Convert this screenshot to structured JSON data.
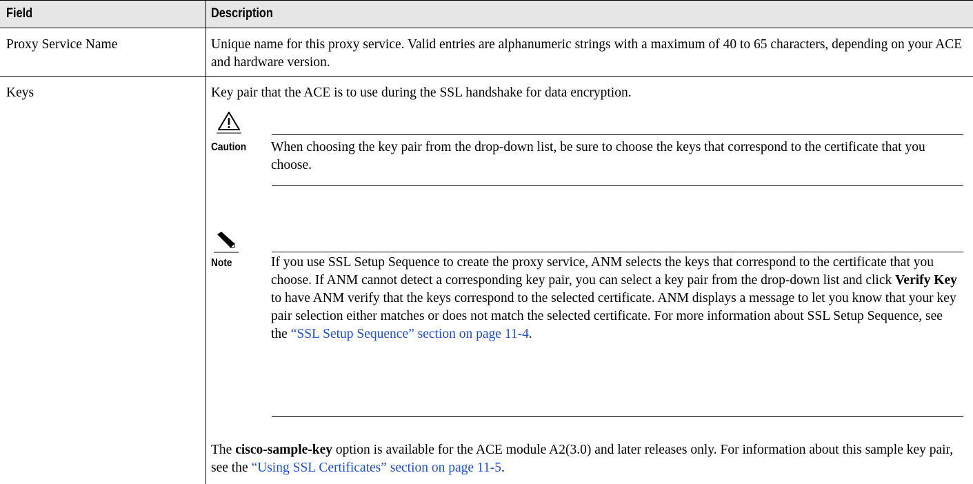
{
  "table": {
    "headers": {
      "field": "Field",
      "description": "Description"
    },
    "rows": [
      {
        "field": "Proxy Service Name",
        "description": "Unique name for this proxy service. Valid entries are alphanumeric strings with a maximum of 40 to 65 characters, depending on your ACE and hardware version."
      },
      {
        "field": "Keys",
        "description": "Key pair that the ACE is to use during the SSL handshake for data encryption.",
        "caution": {
          "label": "Caution",
          "icon": "caution-triangle-icon",
          "text": "When choosing the key pair from the drop-down list, be sure to choose the keys that correspond to the certificate that you choose."
        },
        "note": {
          "label": "Note",
          "icon": "pencil-note-icon",
          "text_1": "If you use SSL Setup Sequence to create the proxy service, ANM selects the keys that correspond to the certificate that you choose. If ANM cannot detect a corresponding key pair, you can select a key pair from the drop-down list and click ",
          "bold_1": "Verify Key",
          "text_2": " to have ANM verify that the keys correspond to the selected certificate. ANM displays a message to let you know that your key pair selection either matches or does not match the selected certificate. For more information about SSL Setup Sequence, see the ",
          "link": "“SSL Setup Sequence” section on page 11-4",
          "text_3": "."
        },
        "footer": {
          "text_1": "The ",
          "bold": "cisco-sample-key",
          "text_2": " option is available for the ACE module A2(3.0) and later releases only. For information about this sample key pair, see the ",
          "link": "“Using SSL Certificates” section on page 11-5",
          "text_3": "."
        }
      }
    ]
  },
  "colors": {
    "header_bg": "#e6e6e6",
    "link": "#1f4fd1"
  }
}
